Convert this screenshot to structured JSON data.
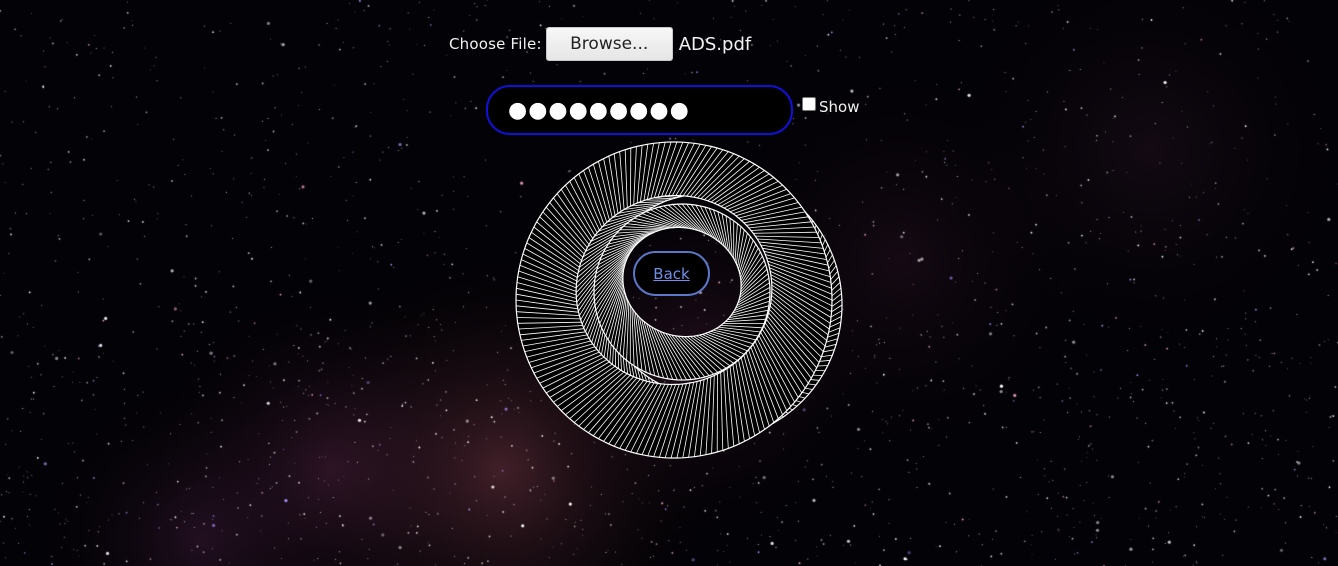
{
  "file_input": {
    "label": "Choose File:",
    "button_label": "Browse...",
    "selected_file": "ADS.pdf"
  },
  "password": {
    "masked_value": "●●●●●●●●●",
    "show_label": "Show",
    "show_checked": false
  },
  "back_link": {
    "label": "Back"
  },
  "colors": {
    "password_border": "#1010d8",
    "back_border": "#5b77c8",
    "back_text": "#6f8fe8"
  }
}
